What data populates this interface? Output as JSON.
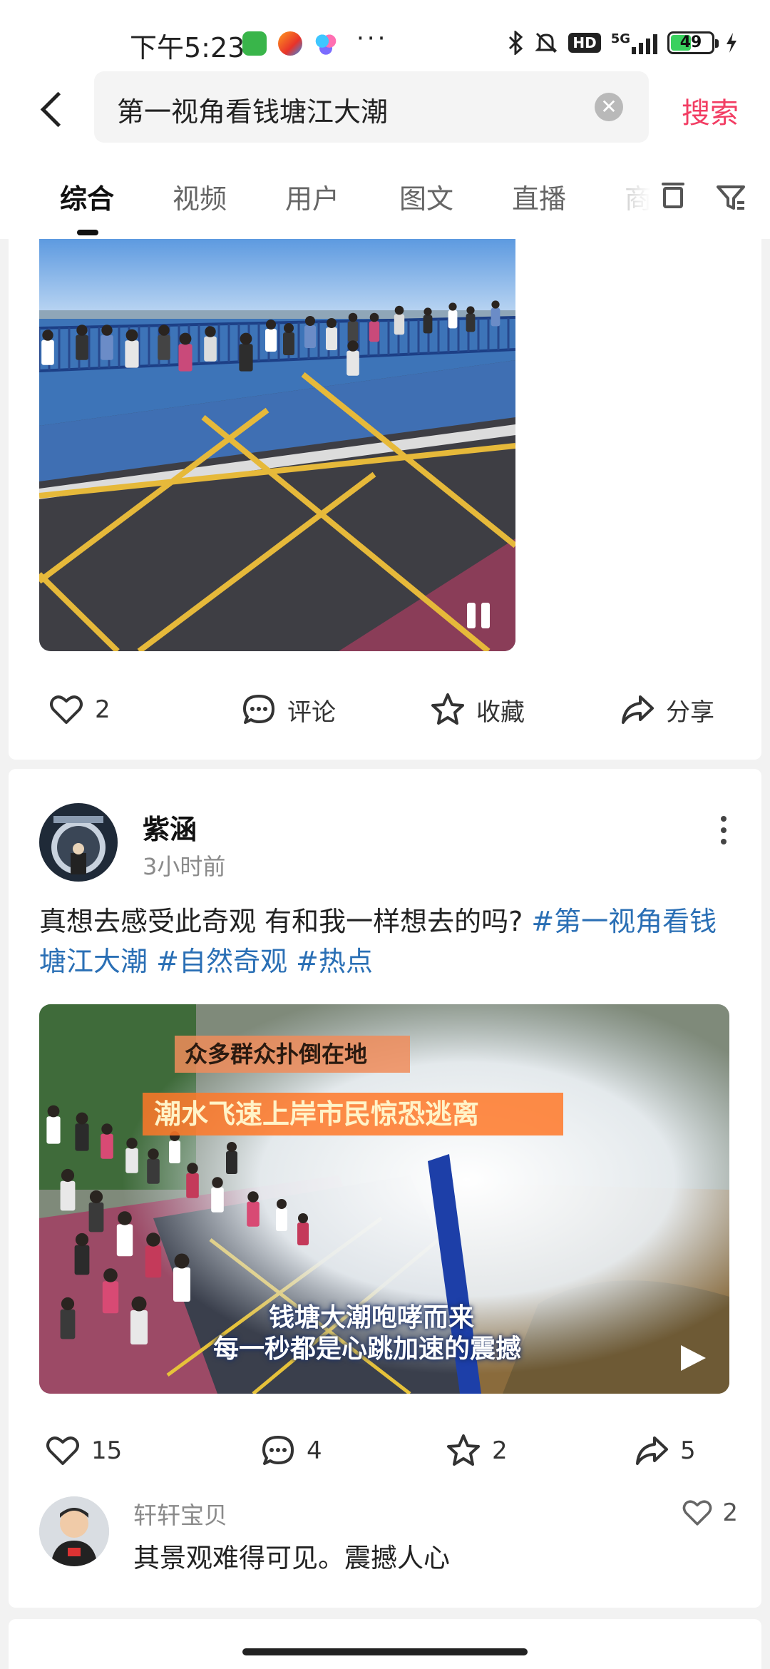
{
  "status_bar": {
    "time": "下午5:23",
    "more": "···",
    "network": "5G",
    "battery": "49",
    "battery_level": 0.49
  },
  "search": {
    "query": "第一视角看钱塘江大潮",
    "button_label": "搜索"
  },
  "tabs": [
    {
      "label": "综合",
      "active": true
    },
    {
      "label": "视频",
      "active": false
    },
    {
      "label": "用户",
      "active": false
    },
    {
      "label": "图文",
      "active": false
    },
    {
      "label": "直播",
      "active": false
    },
    {
      "label": "商",
      "active": false
    }
  ],
  "post1": {
    "likes": "2",
    "comment_label": "评论",
    "favorite_label": "收藏",
    "share_label": "分享"
  },
  "post2": {
    "author": "紫涵",
    "time": "3小时前",
    "text": "真想去感受此奇观 有和我一样想去的吗?",
    "hashtags": [
      "#第一视角看钱塘江大潮",
      "#自然奇观",
      "#热点"
    ],
    "video_captions": {
      "top1": "众多群众扑倒在地",
      "top2": "潮水飞速上岸市民惊恐逃离",
      "bottom1": "钱塘大潮咆哮而来",
      "bottom2": "每一秒都是心跳加速的震撼"
    },
    "likes": "15",
    "comments": "4",
    "favorites": "2",
    "shares": "5",
    "top_comment": {
      "user": "轩轩宝贝",
      "text": "其景观难得可见。震撼人心",
      "likes": "2"
    }
  }
}
